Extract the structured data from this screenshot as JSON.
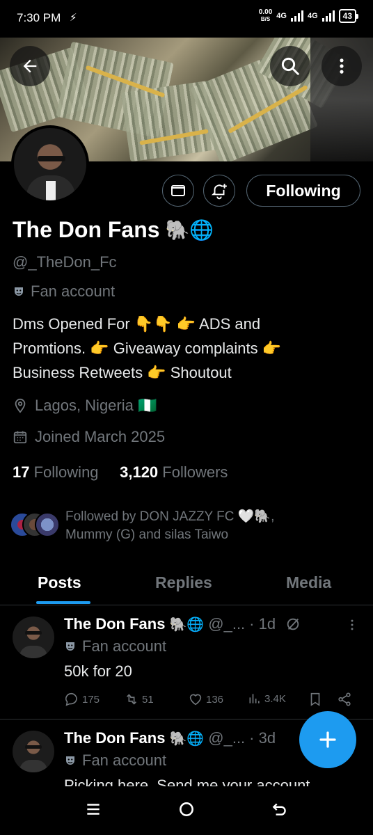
{
  "status_bar": {
    "time": "7:30 PM",
    "charge_icon": "⚡",
    "net_speed_value": "0.00",
    "net_speed_unit": "B/S",
    "network1": "4G",
    "network2": "4G",
    "battery": "43"
  },
  "header": {
    "back_icon": "arrow-left-icon",
    "search_icon": "search-icon",
    "more_icon": "more-vertical-icon"
  },
  "profile": {
    "name": "The Don Fans",
    "name_emojis": "🐘🌐",
    "handle": "@_TheDon_Fc",
    "category": "Fan account",
    "bio_lines": [
      "Dms Opened For 👇👇  👉 ADS and",
      "Promtions. 👉 Giveaway complaints  👉",
      "Business Retweets  👉 Shoutout"
    ],
    "location": "Lagos, Nigeria 🇳🇬",
    "joined": "Joined March 2025",
    "following_count": "17",
    "following_label": "Following",
    "followers_count": "3,120",
    "followers_label": "Followers",
    "followed_by_line1": "Followed by DON JAZZY FC 🤍🐘,",
    "followed_by_line2": "Mummy (G) and silas Taiwo",
    "follow_button_label": "Following"
  },
  "tabs": [
    {
      "label": "Posts",
      "active": true
    },
    {
      "label": "Replies",
      "active": false
    },
    {
      "label": "Media",
      "active": false
    }
  ],
  "posts": [
    {
      "name": "The Don Fans",
      "emojis": "🐘🌐",
      "handle": "@_...",
      "time": "· 1d",
      "category": "Fan account",
      "text": "50k for 20",
      "replies": "175",
      "reposts": "51",
      "likes": "136",
      "views": "3.4K"
    },
    {
      "name": "The Don Fans",
      "emojis": "🐘🌐",
      "handle": "@_...",
      "time": "· 3d",
      "category": "Fan account",
      "text": "Picking here. Send me your account"
    }
  ],
  "colors": {
    "accent": "#1d9bf0",
    "muted": "#71767b",
    "border": "#2f3336",
    "background": "#000000"
  },
  "fab_icon": "plus-icon",
  "nav": {
    "menu_icon": "menu-icon",
    "home_icon": "home-circle-icon",
    "back_icon": "back-icon"
  }
}
